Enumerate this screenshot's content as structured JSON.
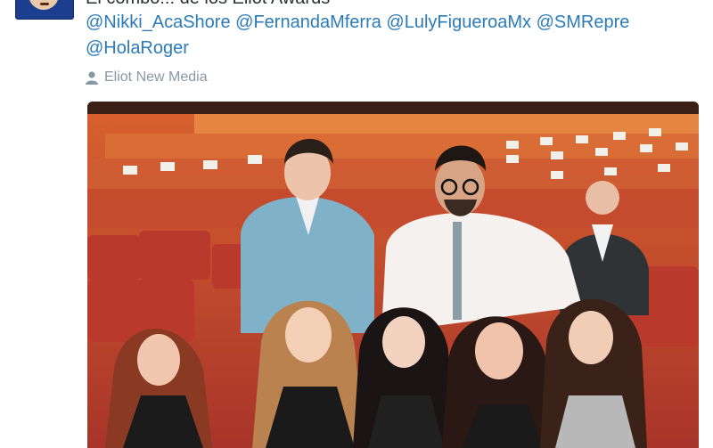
{
  "tweet": {
    "title_partial": "El combo!!! de los Eliot Awards",
    "mentions": [
      "@Nikki_AcaShore",
      "@FernandaMferra",
      "@LulyFigueroaMx",
      "@SMRepre",
      "@HolaRoger"
    ],
    "byline": "Eliot New Media",
    "byline_icon": "person-icon",
    "avatar_icon": "avatar-icon"
  },
  "colors": {
    "link": "#2b7bb9",
    "text": "#292f33",
    "muted": "#8899a6",
    "seat_red": "#c9442c",
    "floor": "#b85a2e"
  }
}
